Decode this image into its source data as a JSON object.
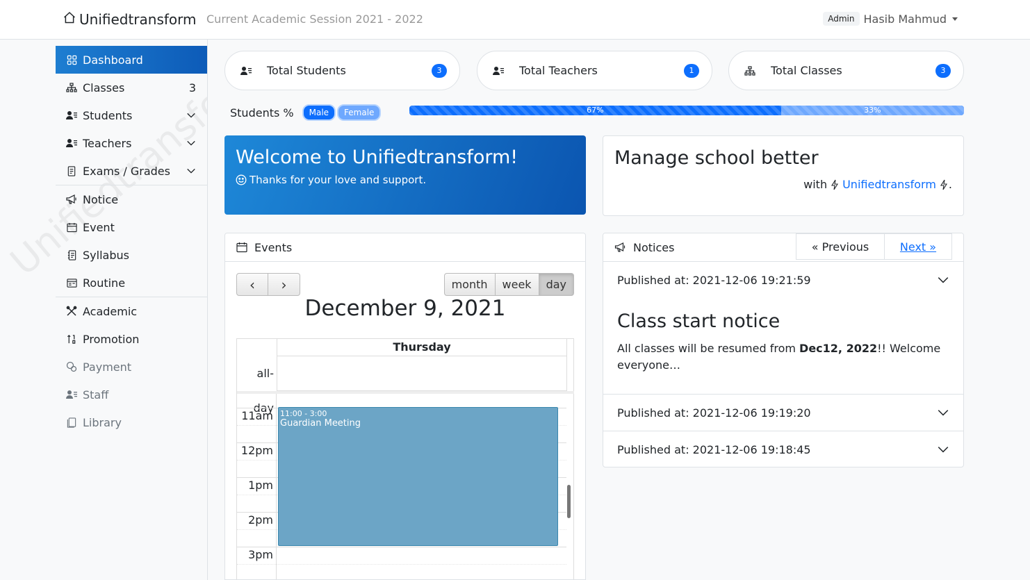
{
  "header": {
    "brand": "Unifiedtransform",
    "session": "Current Academic Session 2021 - 2022",
    "role": "Admin",
    "user_name": "Hasib Mahmud"
  },
  "sidebar": {
    "watermark": "Unifiedtransform",
    "items": [
      {
        "label": "Dashboard",
        "icon": "grid-icon",
        "active": true
      },
      {
        "label": "Classes",
        "icon": "diagram-icon",
        "count": "3"
      },
      {
        "label": "Students",
        "icon": "person-lines-icon"
      },
      {
        "label": "Teachers",
        "icon": "person-lines-icon"
      },
      {
        "label": "Exams / Grades",
        "icon": "file-text-icon"
      },
      {
        "label": "Notice",
        "icon": "megaphone-icon"
      },
      {
        "label": "Event",
        "icon": "calendar-icon"
      },
      {
        "label": "Syllabus",
        "icon": "journal-text-icon"
      },
      {
        "label": "Routine",
        "icon": "calendar-week-icon"
      },
      {
        "label": "Academic",
        "icon": "tools-icon"
      },
      {
        "label": "Promotion",
        "icon": "sort-numeric-up-icon"
      },
      {
        "label": "Payment",
        "icon": "cash-coin-icon"
      },
      {
        "label": "Staff",
        "icon": "person-lines-icon"
      },
      {
        "label": "Library",
        "icon": "journals-icon"
      }
    ]
  },
  "stats": {
    "students": {
      "label": "Total Students",
      "count": "3"
    },
    "teachers": {
      "label": "Total Teachers",
      "count": "1"
    },
    "classes": {
      "label": "Total Classes",
      "count": "3"
    }
  },
  "gender": {
    "label": "Students %",
    "male_label": "Male",
    "female_label": "Female",
    "male_pct": 67,
    "female_pct": 33,
    "male_text": "67%",
    "female_text": "33%"
  },
  "welcome": {
    "title": "Welcome to Unifiedtransform!",
    "subtitle": "Thanks for your love and support."
  },
  "manage": {
    "title": "Manage school better",
    "with": "with",
    "link": "Unifiedtransform",
    "period": "."
  },
  "events": {
    "title": "Events",
    "prev": "‹",
    "next": "›",
    "views": [
      "month",
      "week",
      "day"
    ],
    "date_title": "December 9, 2021",
    "day_name": "Thursday",
    "allday": "all-day",
    "times": [
      "11am",
      "12pm",
      "1pm",
      "2pm",
      "3pm"
    ],
    "event_time": "11:00 - 3:00",
    "event_title": "Guardian Meeting"
  },
  "notices": {
    "title": "Notices",
    "prev": "« Previous",
    "next": "Next »",
    "items": [
      {
        "published": "Published at: 2021-12-06 19:21:59",
        "title": "Class start notice",
        "body_pre": "All classes will be resumed from ",
        "body_bold": "Dec12, 2022",
        "body_post": "!! Welcome everyone…"
      },
      {
        "published": "Published at: 2021-12-06 19:19:20"
      },
      {
        "published": "Published at: 2021-12-06 19:18:45"
      }
    ]
  },
  "colors": {
    "primary": "#0d6efd",
    "event": "#6ca5c6"
  }
}
